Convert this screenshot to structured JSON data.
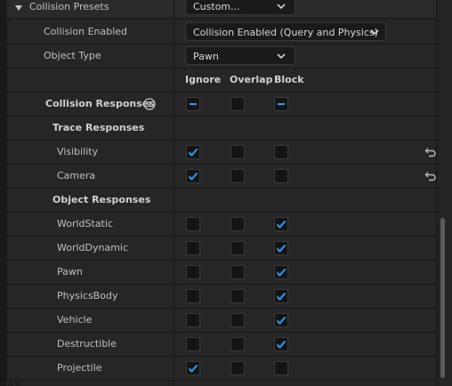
{
  "collision_presets": {
    "label": "Collision Presets",
    "value": "Custom..."
  },
  "collision_enabled": {
    "label": "Collision Enabled",
    "value": "Collision Enabled (Query and Physics)"
  },
  "object_type": {
    "label": "Object Type",
    "value": "Pawn"
  },
  "columns": {
    "ignore": "Ignore",
    "overlap": "Overlap",
    "block": "Block"
  },
  "collision_responses": {
    "label": "Collision Responses",
    "ignore": "mixed",
    "overlap": "unchecked",
    "block": "mixed"
  },
  "trace_responses": {
    "label": "Trace Responses",
    "rows": [
      {
        "label": "Visibility",
        "ignore": true,
        "overlap": false,
        "block": false
      },
      {
        "label": "Camera",
        "ignore": true,
        "overlap": false,
        "block": false
      }
    ]
  },
  "object_responses": {
    "label": "Object Responses",
    "rows": [
      {
        "label": "WorldStatic",
        "ignore": false,
        "overlap": false,
        "block": true
      },
      {
        "label": "WorldDynamic",
        "ignore": false,
        "overlap": false,
        "block": true
      },
      {
        "label": "Pawn",
        "ignore": false,
        "overlap": false,
        "block": true
      },
      {
        "label": "PhysicsBody",
        "ignore": false,
        "overlap": false,
        "block": true
      },
      {
        "label": "Vehicle",
        "ignore": false,
        "overlap": false,
        "block": true
      },
      {
        "label": "Destructible",
        "ignore": false,
        "overlap": false,
        "block": true
      },
      {
        "label": "Projectile",
        "ignore": true,
        "overlap": false,
        "block": false
      }
    ]
  },
  "colors": {
    "accent": "#2a9cf0",
    "background": "#242424"
  }
}
